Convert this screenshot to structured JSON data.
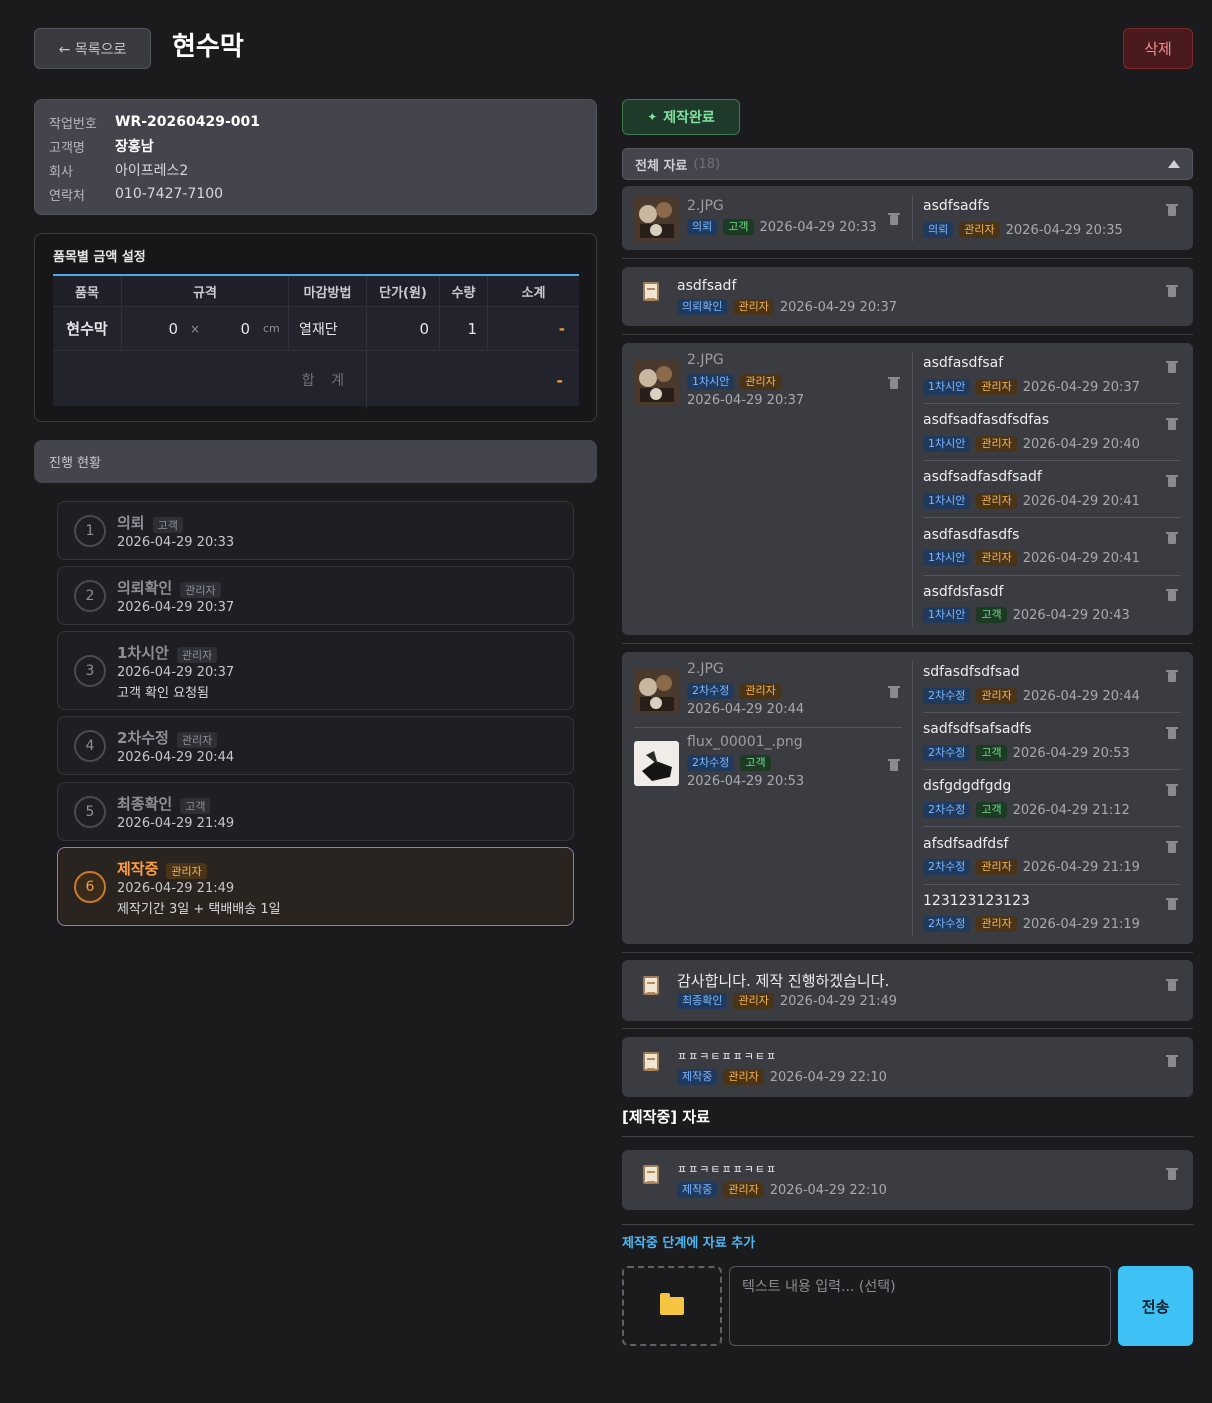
{
  "header": {
    "back_label": "← 목록으로",
    "title": "현수막",
    "delete_label": "삭제"
  },
  "info": {
    "work_no_label": "작업번호",
    "work_no": "WR-20260429-001",
    "customer_label": "고객명",
    "customer": "장홍남",
    "company_label": "회사",
    "company": "아이프레스2",
    "contact_label": "연락처",
    "contact": "010-7427-7100"
  },
  "pricing": {
    "title": "품목별 금액 설정",
    "headers": [
      "품목",
      "규격",
      "마감방법",
      "단가(원)",
      "수량",
      "소계"
    ],
    "row": {
      "item": "현수막",
      "width": "0",
      "times": "×",
      "height": "0",
      "unit": "cm",
      "finish": "열재단",
      "unit_price": "0",
      "qty": "1",
      "subtotal": "-"
    },
    "total_label": "합 계",
    "total_value": "-"
  },
  "progress": {
    "title": "진행 현황",
    "steps": [
      {
        "num": "1",
        "name": "의뢰",
        "role": "고객",
        "date": "2026-04-29 20:33",
        "note": ""
      },
      {
        "num": "2",
        "name": "의뢰확인",
        "role": "관리자",
        "date": "2026-04-29 20:37",
        "note": ""
      },
      {
        "num": "3",
        "name": "1차시안",
        "role": "관리자",
        "date": "2026-04-29 20:37",
        "note": "고객 확인 요청됨"
      },
      {
        "num": "4",
        "name": "2차수정",
        "role": "관리자",
        "date": "2026-04-29 20:44",
        "note": ""
      },
      {
        "num": "5",
        "name": "최종확인",
        "role": "고객",
        "date": "2026-04-29 21:49",
        "note": ""
      },
      {
        "num": "6",
        "name": "제작중",
        "role": "관리자",
        "date": "2026-04-29 21:49",
        "note": "제작기간 3일 + 택배배송 1일"
      }
    ]
  },
  "status_badge": {
    "icon": "party-icon",
    "label": "제작완료"
  },
  "all_files": {
    "title": "전체 자료",
    "count": "(18)"
  },
  "groups": {
    "g1": {
      "file": {
        "name": "2.JPG",
        "stage": "의뢰",
        "role": "고객",
        "date": "2026-04-29 20:33"
      },
      "notes": [
        {
          "text": "asdfsadfs",
          "stage": "의뢰",
          "role": "관리자",
          "date": "2026-04-29 20:35"
        }
      ]
    },
    "g2": {
      "text": "asdfsadf",
      "stage": "의뢰확인",
      "role": "관리자",
      "date": "2026-04-29 20:37"
    },
    "g3": {
      "file": {
        "name": "2.JPG",
        "stage": "1차시안",
        "role": "관리자",
        "date": "2026-04-29 20:37"
      },
      "notes": [
        {
          "text": "asdfasdfsaf",
          "stage": "1차시안",
          "role": "관리자",
          "date": "2026-04-29 20:37"
        },
        {
          "text": "asdfsadfasdfsdfas",
          "stage": "1차시안",
          "role": "관리자",
          "date": "2026-04-29 20:40"
        },
        {
          "text": "asdfsadfasdfsadf",
          "stage": "1차시안",
          "role": "관리자",
          "date": "2026-04-29 20:41"
        },
        {
          "text": "asdfasdfasdfs",
          "stage": "1차시안",
          "role": "관리자",
          "date": "2026-04-29 20:41"
        },
        {
          "text": "asdfdsfasdf",
          "stage": "1차시안",
          "role": "고객",
          "date": "2026-04-29 20:43"
        }
      ]
    },
    "g4": {
      "files": [
        {
          "name": "2.JPG",
          "stage": "2차수정",
          "role": "관리자",
          "date": "2026-04-29 20:44"
        },
        {
          "name": "flux_00001_.png",
          "stage": "2차수정",
          "role": "고객",
          "date": "2026-04-29 20:53"
        }
      ],
      "notes": [
        {
          "text": "sdfasdfsdfsad",
          "stage": "2차수정",
          "role": "관리자",
          "date": "2026-04-29 20:44"
        },
        {
          "text": "sadfsdfsafsadfs",
          "stage": "2차수정",
          "role": "고객",
          "date": "2026-04-29 20:53"
        },
        {
          "text": "dsfgdgdfgdg",
          "stage": "2차수정",
          "role": "고객",
          "date": "2026-04-29 21:12"
        },
        {
          "text": "afsdfsadfdsf",
          "stage": "2차수정",
          "role": "관리자",
          "date": "2026-04-29 21:19"
        },
        {
          "text": "123123123123",
          "stage": "2차수정",
          "role": "관리자",
          "date": "2026-04-29 21:19"
        }
      ]
    },
    "g5": {
      "text": "감사합니다. 제작 진행하겠습니다.",
      "stage": "최종확인",
      "role": "관리자",
      "date": "2026-04-29 21:49"
    },
    "g6": {
      "text": "ㅍㅍㅋㅌㅍㅍㅋㅌㅍ",
      "stage": "제작중",
      "role": "관리자",
      "date": "2026-04-29 22:10"
    }
  },
  "stage_section": {
    "title": "[제작중] 자료",
    "item": {
      "text": "ㅍㅍㅋㅌㅍㅍㅋㅌㅍ",
      "stage": "제작중",
      "role": "관리자",
      "date": "2026-04-29 22:10"
    }
  },
  "add_form": {
    "title": "제작중 단계에 자료 추가",
    "upload_icon": "folder-icon",
    "placeholder": "텍스트 내용 입력... (선택)",
    "send_label": "전송"
  }
}
